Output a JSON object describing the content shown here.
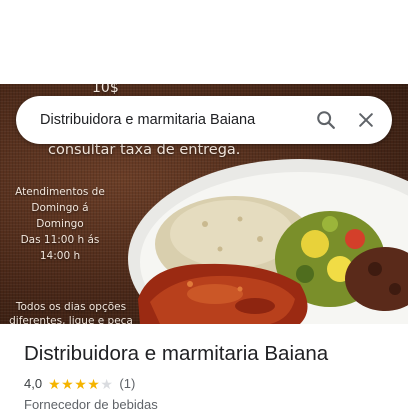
{
  "hero": {
    "price_text": "10$",
    "delivery_text": "consultar taxa de entrega.",
    "hours_text": "Atendimentos de\nDomingo á\nDomingo\nDas 11:00 h ás\n14:00 h",
    "promo_text": "Todos os dias opções\ndiferentes, ligue e peça já o"
  },
  "search": {
    "value": "Distribuidora e marmitaria Baiana",
    "search_icon": "search-icon",
    "close_icon": "close-icon"
  },
  "place": {
    "title": "Distribuidora e marmitaria Baiana",
    "rating": "4,0",
    "stars_filled": 4,
    "stars_total": 5,
    "reviews_count": "(1)",
    "category": "Fornecedor de bebidas"
  },
  "colors": {
    "star_filled": "#f5b400",
    "star_empty": "#dadce0",
    "text_primary": "#202124",
    "text_secondary": "#5f6368"
  }
}
